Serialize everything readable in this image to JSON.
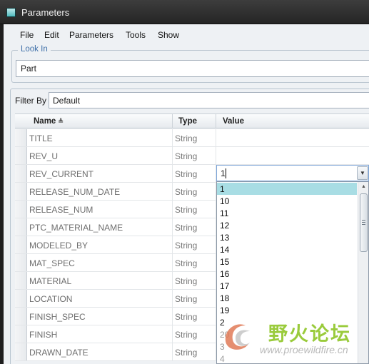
{
  "window": {
    "title": "Parameters"
  },
  "menu": [
    "File",
    "Edit",
    "Parameters",
    "Tools",
    "Show"
  ],
  "look_in": {
    "label": "Look In",
    "value": "Part"
  },
  "filter": {
    "label": "Filter By",
    "value": "Default"
  },
  "table": {
    "headers": {
      "name": "Name",
      "type": "Type",
      "value": "Value"
    },
    "sort_indicator": "≜",
    "rows": [
      {
        "name": "TITLE",
        "type": "String",
        "value": ""
      },
      {
        "name": "REV_U",
        "type": "String",
        "value": ""
      },
      {
        "name": "REV_CURRENT",
        "type": "String",
        "value": "1"
      },
      {
        "name": "RELEASE_NUM_DATE",
        "type": "String",
        "value": ""
      },
      {
        "name": "RELEASE_NUM",
        "type": "String",
        "value": ""
      },
      {
        "name": "PTC_MATERIAL_NAME",
        "type": "String",
        "value": ""
      },
      {
        "name": "MODELED_BY",
        "type": "String",
        "value": ""
      },
      {
        "name": "MAT_SPEC",
        "type": "String",
        "value": ""
      },
      {
        "name": "MATERIAL",
        "type": "String",
        "value": ""
      },
      {
        "name": "LOCATION",
        "type": "String",
        "value": ""
      },
      {
        "name": "FINISH_SPEC",
        "type": "String",
        "value": ""
      },
      {
        "name": "FINISH",
        "type": "String",
        "value": ""
      },
      {
        "name": "DRAWN_DATE",
        "type": "String",
        "value": ""
      }
    ]
  },
  "value_dropdown": {
    "current": "1",
    "selected_index": 0,
    "options": [
      "1",
      "10",
      "11",
      "12",
      "13",
      "14",
      "15",
      "16",
      "17",
      "18",
      "19",
      "2",
      "20",
      "3",
      "4"
    ]
  },
  "watermark": {
    "logo_text": "野火论坛",
    "url": "www.proewildfire.cn"
  },
  "colors": {
    "selection": "#a8dde4",
    "legend": "#3e6fa8",
    "titlebar": "#2e2e2e",
    "watermark_green": "#9acb3c"
  }
}
